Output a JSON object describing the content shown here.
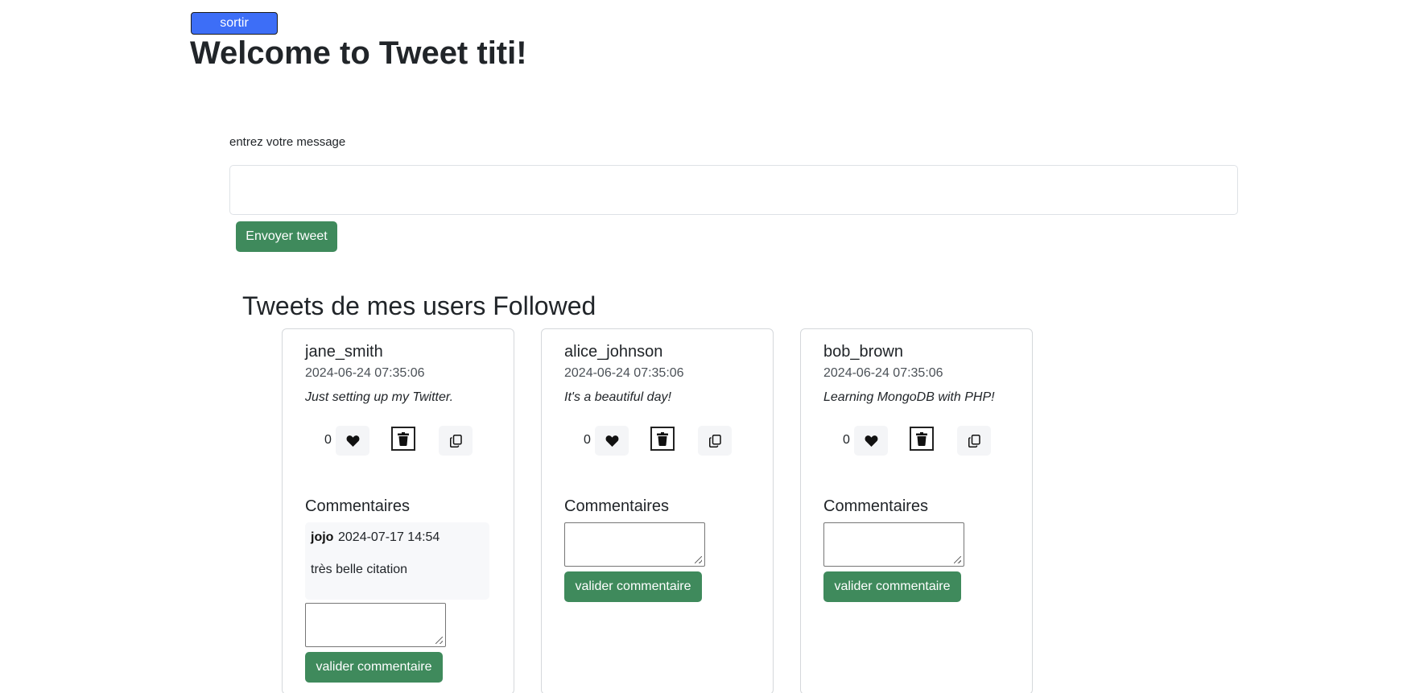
{
  "header": {
    "logout_label": "sortir",
    "welcome": "Welcome to Tweet titi!"
  },
  "compose": {
    "label": "entrez votre message",
    "value": "",
    "send_label": "Envoyer tweet"
  },
  "feed": {
    "title": "Tweets de mes users Followed",
    "comments_heading": "Commentaires",
    "validate_label": "valider commentaire",
    "tweets": [
      {
        "author": "jane_smith",
        "date": "2024-06-24 07:35:06",
        "message": "Just setting up my Twitter.",
        "likes": "0",
        "comments": [
          {
            "author": "jojo",
            "date": "2024-07-17 14:54",
            "text": "très belle citation"
          }
        ]
      },
      {
        "author": "alice_johnson",
        "date": "2024-06-24 07:35:06",
        "message": "It's a beautiful day!",
        "likes": "0",
        "comments": []
      },
      {
        "author": "bob_brown",
        "date": "2024-06-24 07:35:06",
        "message": "Learning MongoDB with PHP!",
        "likes": "0",
        "comments": []
      }
    ]
  },
  "icons": {
    "like": "heart-icon",
    "delete": "trash-icon",
    "copy": "copy-icon"
  },
  "colors": {
    "primary_button": "#3d6ef7",
    "success_button": "#3f8a5c"
  }
}
